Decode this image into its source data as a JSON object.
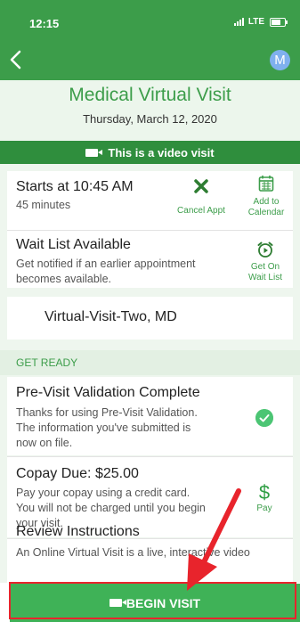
{
  "status": {
    "time": "12:15",
    "network": "LTE"
  },
  "nav": {
    "avatar_initial": "M"
  },
  "visit": {
    "title": "Medical Virtual Visit",
    "date": "Thursday, March 12, 2020",
    "video_banner": "This is a video visit"
  },
  "appointment": {
    "start": "Starts at 10:45 AM",
    "duration": "45 minutes",
    "cancel_label": "Cancel Appt",
    "calendar_label_1": "Add to",
    "calendar_label_2": "Calendar"
  },
  "waitlist": {
    "title": "Wait List Available",
    "desc_1": "Get notified if an earlier appointment",
    "desc_2": "becomes available.",
    "action_label_1": "Get On",
    "action_label_2": "Wait List"
  },
  "provider": {
    "name": "Virtual-Visit-Two, MD"
  },
  "get_ready": {
    "header": "GET READY"
  },
  "previsit": {
    "title": "Pre-Visit Validation Complete",
    "desc_1": "Thanks for using Pre-Visit Validation.",
    "desc_2": "The information you've submitted is",
    "desc_3": "now on file."
  },
  "copay": {
    "title": "Copay Due: $25.00",
    "desc_1": "Pay your copay using a credit card.",
    "desc_2": "You will not be charged until you begin",
    "desc_3": "your visit.",
    "pay_symbol": "$",
    "pay_label": "Pay"
  },
  "instructions": {
    "title": "Review Instructions",
    "desc_1": "An Online Virtual Visit is a live, interactive video"
  },
  "footer": {
    "begin_label": "BEGIN VISIT"
  },
  "colors": {
    "brand_green": "#3c9d4a",
    "banner_green": "#2f8e3d",
    "button_green": "#3fb257",
    "annotation_red": "#e8242c"
  }
}
